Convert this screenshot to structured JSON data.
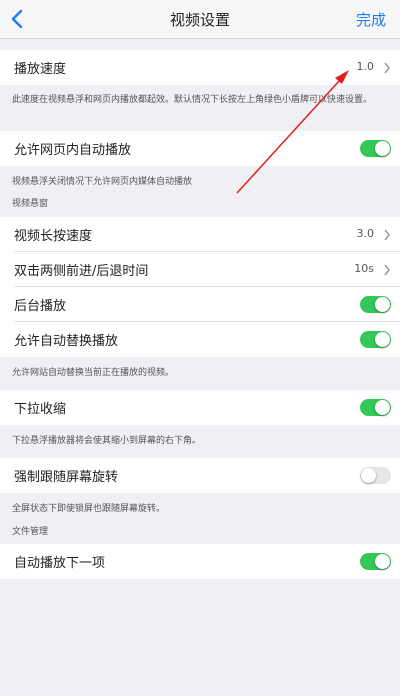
{
  "nav": {
    "title": "视频设置",
    "done_label": "完成"
  },
  "playback_speed": {
    "label": "播放速度",
    "value": "1.0"
  },
  "playback_note": "此速度在视频悬浮和网页内播放都起效。默认情况下长按左上角绿色小盾牌可以快速设置。",
  "web_autoplay": {
    "label": "允许网页内自动播放",
    "enabled": true
  },
  "web_autoplay_note": "视频悬浮关闭情况下允许网页内媒体自动播放",
  "section_floating": "视频悬窗",
  "long_press_speed": {
    "label": "视频长按速度",
    "value": "3.0"
  },
  "double_tap": {
    "label": "双击两侧前进/后退时间",
    "value": "10s"
  },
  "background_play": {
    "label": "后台播放",
    "enabled": true
  },
  "auto_replace": {
    "label": "允许自动替换播放",
    "enabled": true
  },
  "auto_replace_note": "允许网站自动替换当前正在播放的视频。",
  "pull_shrink": {
    "label": "下拉收缩",
    "enabled": true
  },
  "pull_shrink_note": "下拉悬浮播放器将会使其缩小到屏幕的右下角。",
  "force_rotate": {
    "label": "强制跟随屏幕旋转",
    "enabled": false
  },
  "force_rotate_note": "全屏状态下即使锁屏也跟随屏幕旋转。",
  "section_file": "文件管理",
  "autoplay_next": {
    "label": "自动播放下一项",
    "enabled": true
  },
  "colors": {
    "accent": "#1a7cf5",
    "toggle_on": "#34c759",
    "annotation": "#e02020"
  }
}
